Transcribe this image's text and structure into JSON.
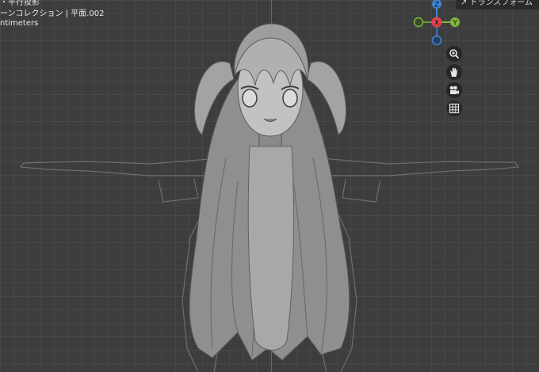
{
  "viewport": {
    "line1": "・平行投影",
    "line2": "ーンコレクション | 平面.002",
    "line3": "ntimeters"
  },
  "sidebar_tab": {
    "label": "トランスフォーム"
  },
  "gizmo": {
    "z_label": "Z",
    "x_label": "X",
    "y_label": "Y"
  },
  "nav_icons": [
    "zoom-icon",
    "hand-pan-icon",
    "camera-icon",
    "grid-ortho-icon"
  ],
  "colors": {
    "x_axis": "#e0434f",
    "y_axis": "#7fb83a",
    "z_axis": "#3f86d8",
    "background": "#3d3d3d"
  }
}
